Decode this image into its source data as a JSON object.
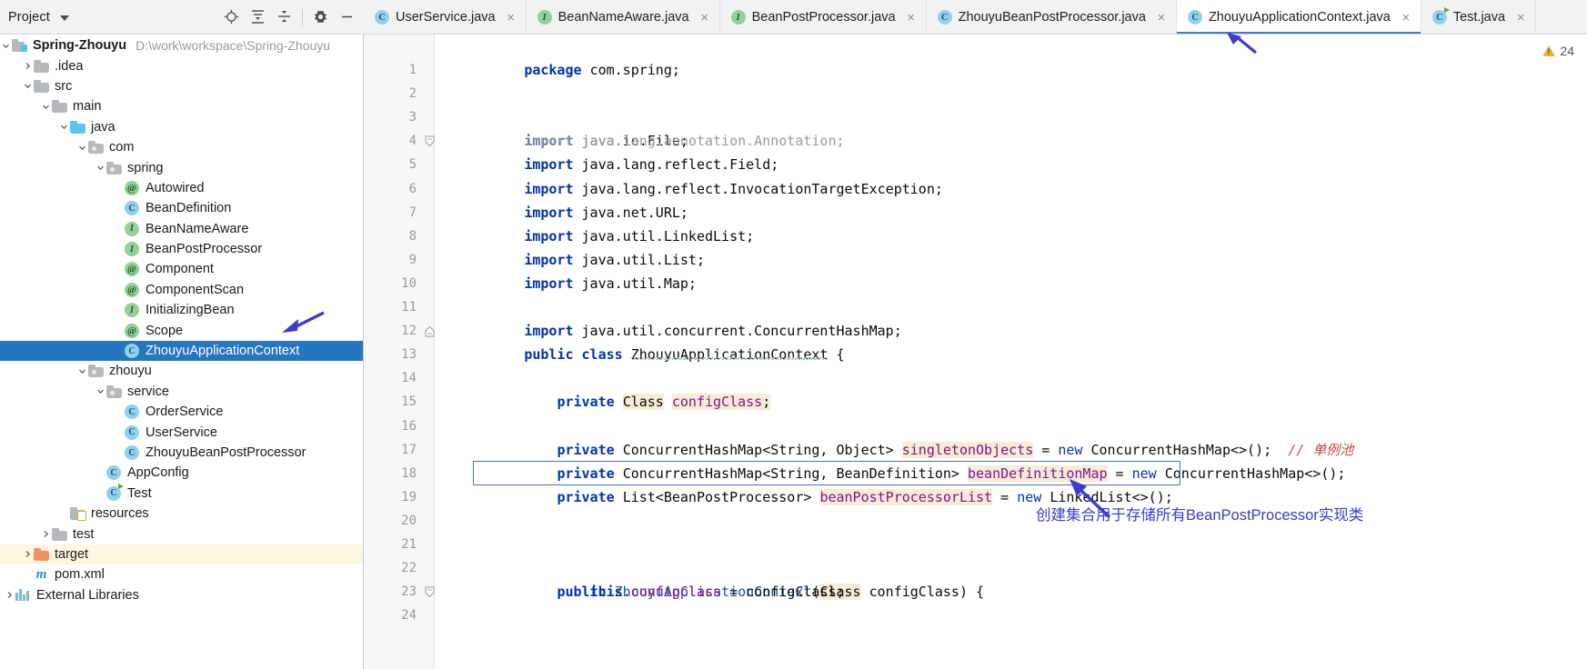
{
  "project_panel": {
    "title": "Project",
    "caret_icon": "chevron-down-icon",
    "toolbar": [
      {
        "name": "locate-icon",
        "tooltip": "Select Opened File"
      },
      {
        "name": "expand-all-icon",
        "tooltip": "Expand All"
      },
      {
        "name": "collapse-all-icon",
        "tooltip": "Collapse All"
      },
      {
        "name": "gear-icon",
        "tooltip": "Settings"
      },
      {
        "name": "minimize-icon",
        "tooltip": "Hide"
      }
    ]
  },
  "tree": {
    "root": {
      "label": "Spring-Zhouyu",
      "path": "D:\\work\\workspace\\Spring-Zhouyu"
    },
    "items": [
      {
        "label": ".idea",
        "indent": 1,
        "icon": "folder",
        "arrow": "right",
        "style": ""
      },
      {
        "label": "src",
        "indent": 1,
        "icon": "folder",
        "arrow": "down",
        "style": ""
      },
      {
        "label": "main",
        "indent": 2,
        "icon": "folder",
        "arrow": "down",
        "style": ""
      },
      {
        "label": "java",
        "indent": 3,
        "icon": "folder-blue",
        "arrow": "down",
        "style": ""
      },
      {
        "label": "com",
        "indent": 4,
        "icon": "folder-pkg",
        "arrow": "down",
        "style": ""
      },
      {
        "label": "spring",
        "indent": 5,
        "icon": "folder-pkg",
        "arrow": "down",
        "style": ""
      },
      {
        "label": "Autowired",
        "indent": 6,
        "icon": "annotation",
        "arrow": "none",
        "style": ""
      },
      {
        "label": "BeanDefinition",
        "indent": 6,
        "icon": "class",
        "arrow": "none",
        "style": ""
      },
      {
        "label": "BeanNameAware",
        "indent": 6,
        "icon": "interface",
        "arrow": "none",
        "style": ""
      },
      {
        "label": "BeanPostProcessor",
        "indent": 6,
        "icon": "interface",
        "arrow": "none",
        "style": ""
      },
      {
        "label": "Component",
        "indent": 6,
        "icon": "annotation",
        "arrow": "none",
        "style": ""
      },
      {
        "label": "ComponentScan",
        "indent": 6,
        "icon": "annotation",
        "arrow": "none",
        "style": ""
      },
      {
        "label": "InitializingBean",
        "indent": 6,
        "icon": "interface",
        "arrow": "none",
        "style": ""
      },
      {
        "label": "Scope",
        "indent": 6,
        "icon": "annotation",
        "arrow": "none",
        "style": ""
      },
      {
        "label": "ZhouyuApplicationContext",
        "indent": 6,
        "icon": "class",
        "arrow": "none",
        "style": "selected"
      },
      {
        "label": "zhouyu",
        "indent": 4,
        "icon": "folder-pkg",
        "arrow": "down",
        "style": ""
      },
      {
        "label": "service",
        "indent": 5,
        "icon": "folder-pkg",
        "arrow": "down",
        "style": ""
      },
      {
        "label": "OrderService",
        "indent": 6,
        "icon": "class",
        "arrow": "none",
        "style": ""
      },
      {
        "label": "UserService",
        "indent": 6,
        "icon": "class",
        "arrow": "none",
        "style": ""
      },
      {
        "label": "ZhouyuBeanPostProcessor",
        "indent": 6,
        "icon": "class",
        "arrow": "none",
        "style": ""
      },
      {
        "label": "AppConfig",
        "indent": 5,
        "icon": "class",
        "arrow": "none",
        "style": ""
      },
      {
        "label": "Test",
        "indent": 5,
        "icon": "class-run",
        "arrow": "none",
        "style": ""
      },
      {
        "label": "resources",
        "indent": 3,
        "icon": "folder-res",
        "arrow": "none",
        "style": ""
      },
      {
        "label": "test",
        "indent": 2,
        "icon": "folder",
        "arrow": "right",
        "style": ""
      },
      {
        "label": "target",
        "indent": 1,
        "icon": "folder-orange",
        "arrow": "right",
        "style": "highlight"
      },
      {
        "label": "pom.xml",
        "indent": 1,
        "icon": "maven",
        "arrow": "none",
        "style": ""
      },
      {
        "label": "External Libraries",
        "indent": 0,
        "icon": "ext-lib",
        "arrow": "right",
        "style": ""
      }
    ]
  },
  "tabs": [
    {
      "label": "UserService.java",
      "icon": "class",
      "active": false
    },
    {
      "label": "BeanNameAware.java",
      "icon": "interface",
      "active": false
    },
    {
      "label": "BeanPostProcessor.java",
      "icon": "interface",
      "active": false
    },
    {
      "label": "ZhouyuBeanPostProcessor.java",
      "icon": "class",
      "active": false
    },
    {
      "label": "ZhouyuApplicationContext.java",
      "icon": "class",
      "active": true
    },
    {
      "label": "Test.java",
      "icon": "class-run",
      "active": false
    }
  ],
  "tab_close_glyph": "×",
  "editor": {
    "warning_count": "24",
    "warning_icon": "warning-triangle-icon",
    "lines": [
      {
        "n": "1",
        "fold": false
      },
      {
        "n": "2",
        "fold": false
      },
      {
        "n": "3",
        "fold": true
      },
      {
        "n": "4",
        "fold": false
      },
      {
        "n": "5",
        "fold": false
      },
      {
        "n": "6",
        "fold": false
      },
      {
        "n": "7",
        "fold": false
      },
      {
        "n": "8",
        "fold": false
      },
      {
        "n": "9",
        "fold": false
      },
      {
        "n": "10",
        "fold": false
      },
      {
        "n": "11",
        "fold": true
      },
      {
        "n": "12",
        "fold": false
      },
      {
        "n": "13",
        "fold": false
      },
      {
        "n": "14",
        "fold": false
      },
      {
        "n": "15",
        "fold": false
      },
      {
        "n": "16",
        "fold": false
      },
      {
        "n": "17",
        "fold": false
      },
      {
        "n": "18",
        "fold": false
      },
      {
        "n": "19",
        "fold": false
      },
      {
        "n": "20",
        "fold": false
      },
      {
        "n": "21",
        "fold": false
      },
      {
        "n": "22",
        "fold": true
      },
      {
        "n": "23",
        "fold": false
      },
      {
        "n": "24",
        "fold": false
      }
    ],
    "code_text": {
      "l1": "package com.spring;",
      "l3": "import java.io.File;",
      "l4": "import java.lang.annotation.Annotation;",
      "l5": "import java.lang.reflect.Field;",
      "l6": "import java.lang.reflect.InvocationTargetException;",
      "l7": "import java.net.URL;",
      "l8": "import java.util.LinkedList;",
      "l9": "import java.util.List;",
      "l10": "import java.util.Map;",
      "l11": "import java.util.concurrent.ConcurrentHashMap;",
      "l13_kw1": "public",
      "l13_kw2": "class",
      "l13_name": "ZhouyuApplicationContext",
      "l13_brace": "{",
      "l15_kw": "private",
      "l15_type": "Class",
      "l15_field": "configClass",
      "l15_semi": ";",
      "l17_kw": "private",
      "l17_type": "ConcurrentHashMap<String, Object>",
      "l17_field": "singletonObjects",
      "l17_eq": "=",
      "l17_new": "new",
      "l17_ctor": "ConcurrentHashMap<>();",
      "l17_comment": "// 单例池",
      "l18_kw": "private",
      "l18_type": "ConcurrentHashMap<String, BeanDefinition>",
      "l18_field": "beanDefinitionMap",
      "l18_eq": "=",
      "l18_new": "new",
      "l18_ctor": "ConcurrentHashMap<>();",
      "l19_kw": "private",
      "l19_type": "List<BeanPostProcessor>",
      "l19_field": "beanPostProcessorList",
      "l19_eq": "=",
      "l19_new": "new",
      "l19_ctor": "LinkedList<>();",
      "l22_kw": "public",
      "l22_name": "ZhouyuApplicationContext",
      "l22_paren1": "(",
      "l22_type": "Class",
      "l22_param": " configClass)",
      "l22_brace": " {",
      "l23_this": "this",
      "l23_dot": ".",
      "l23_field": "configClass",
      "l23_rest": " = configClass;"
    }
  },
  "annotations": [
    {
      "name": "scope-arrow",
      "kind": "arrow"
    },
    {
      "name": "tab-arrow",
      "kind": "arrow"
    },
    {
      "name": "field-arrow",
      "kind": "arrow"
    },
    {
      "name": "field-note",
      "kind": "text",
      "text": "创建集合用于存储所有BeanPostProcessor实现类"
    }
  ],
  "colors": {
    "selection_blue": "#2675bf",
    "tab_underline": "#3b7dd8",
    "field_purple": "#871094",
    "keyword_blue": "#0033b3",
    "highlight_beige": "#f7ecd4",
    "annotation_blue": "#3b3bd0",
    "warning_yellow": "#e8b63a"
  }
}
